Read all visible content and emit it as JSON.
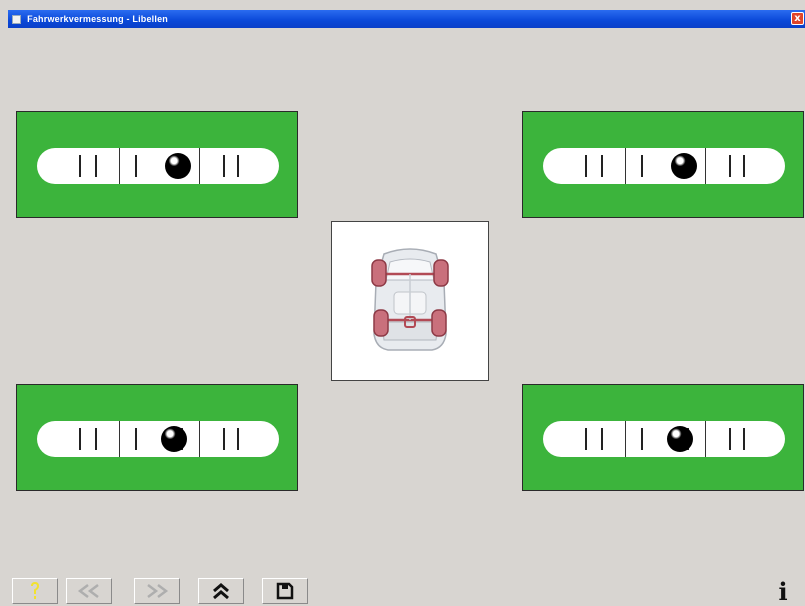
{
  "window": {
    "title": "Fahrwerkvermessung - Libellen",
    "close_label": "x"
  },
  "levels": [
    {
      "id": "front-left",
      "bubble_offset": 0.22
    },
    {
      "id": "front-right",
      "bubble_offset": 0.22
    },
    {
      "id": "rear-left",
      "bubble_offset": 0.18
    },
    {
      "id": "rear-right",
      "bubble_offset": 0.18
    }
  ],
  "colors": {
    "panel": "#3cb43c",
    "titlebar": "#0a48d8",
    "background": "#d8d5d1"
  },
  "toolbar": {
    "buttons": [
      {
        "name": "help-button",
        "icon": "help-icon",
        "enabled": true
      },
      {
        "name": "back-button",
        "icon": "double-left-chevron-icon",
        "enabled": false
      },
      {
        "name": "forward-button",
        "icon": "double-right-chevron-icon",
        "enabled": false
      },
      {
        "name": "home-button",
        "icon": "double-up-chevron-icon",
        "enabled": true
      },
      {
        "name": "save-button",
        "icon": "disk-icon",
        "enabled": true
      }
    ],
    "info_label": "i"
  }
}
